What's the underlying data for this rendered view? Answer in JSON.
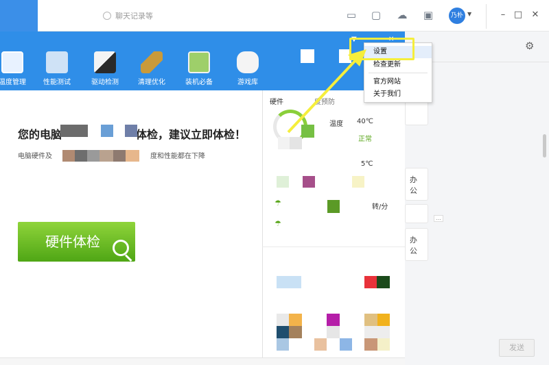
{
  "colors": {
    "accent_blue": "#2f8ee8",
    "check_green": "#59a61a",
    "highlight_yellow": "#f5ee3c",
    "menu_hover": "#e4eefb"
  },
  "chat": {
    "search_placeholder": "聊天记录等",
    "user_name": "乃朴",
    "bubble_texts": [
      "办公",
      "办公"
    ],
    "ellipsis": "...",
    "send_label": "发送",
    "window_controls": {
      "minimize": "–",
      "maximize": "□",
      "close": "✕"
    }
  },
  "tool": {
    "nav": [
      {
        "label": "温度管理",
        "icon": "thermometer-chart-icon",
        "color": "#e8f2ff"
      },
      {
        "label": "性能测试",
        "icon": "performance-icon",
        "color": "#cfe2f6"
      },
      {
        "label": "驱动检测",
        "icon": "driver-icon",
        "color": "#dfe7ef"
      },
      {
        "label": "清理优化",
        "icon": "broom-icon",
        "color": "#c99a3a"
      },
      {
        "label": "装机必备",
        "icon": "box-icon",
        "color": "#9ecf6a"
      },
      {
        "label": "游戏库",
        "icon": "gamepad-icon",
        "color": "#f4f4f4"
      }
    ],
    "window_controls": {
      "menu": "▼",
      "minimize": "–",
      "close": "✕"
    },
    "hero_title_start": "您的电脑",
    "hero_title_end": "体检，建议立即体检！",
    "hero_sub_start": "电脑硬件及",
    "hero_sub_end": "度和性能都在下降",
    "check_button": "硬件体检",
    "right_panel": {
      "title_start": "硬件",
      "title_end": "度预防",
      "metric_label": "温度",
      "temp_1": "40℃",
      "status": "正常",
      "temp_2": "5℃",
      "rpm_unit": "转/分"
    }
  },
  "menu": {
    "items": [
      "设置",
      "检查更新",
      "官方网站",
      "关于我们"
    ]
  }
}
